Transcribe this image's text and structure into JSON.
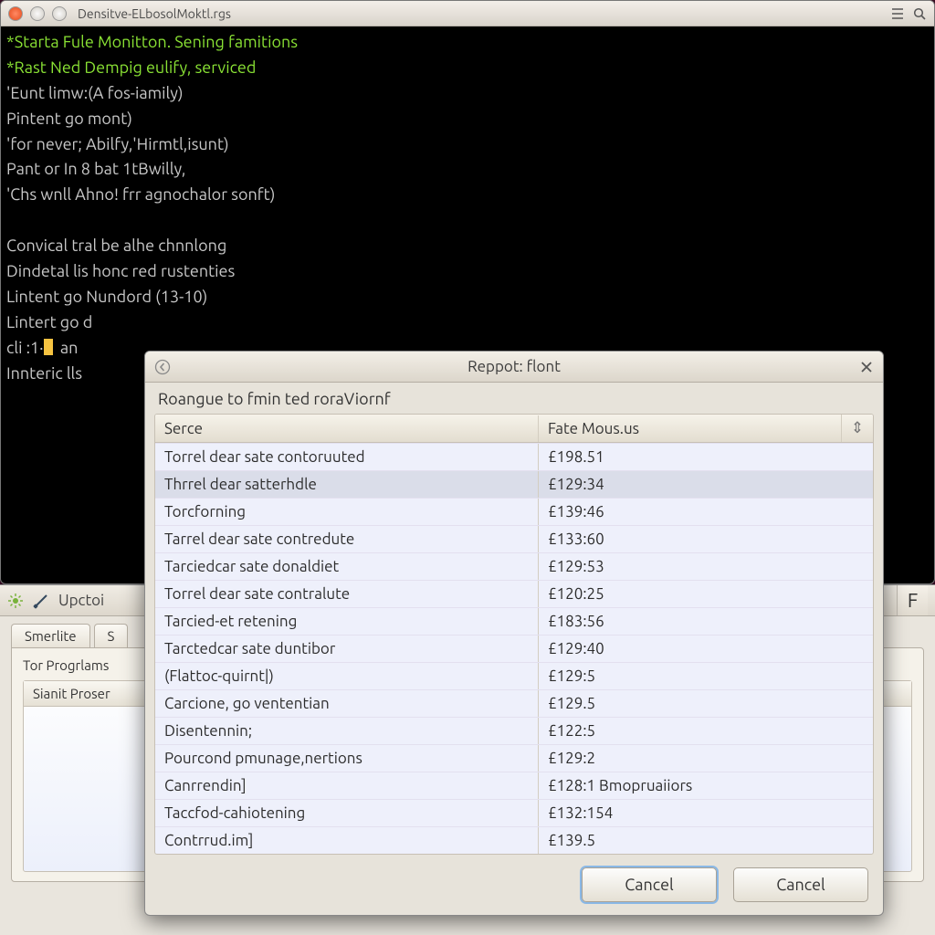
{
  "main_window": {
    "title": "Densitve-ELbosolMoktl.rgs",
    "terminal_lines": [
      {
        "cls": "term-highlight",
        "text": "*Starta Fule Monitton. Sening famitions"
      },
      {
        "cls": "term-highlight",
        "text": "*Rast Ned Dempig eulify, serviced"
      },
      {
        "cls": "term-gray",
        "text": "'Eunt limw:(A fos-iamily)"
      },
      {
        "cls": "term-gray",
        "text": "Pintent go mont)"
      },
      {
        "cls": "term-gray",
        "text": "'for never; Abilfy,'Hirmtl,isunt)"
      },
      {
        "cls": "term-gray",
        "text": "Pant or In 8 bat 1tBwilly,"
      },
      {
        "cls": "term-gray",
        "text": "'Chs wnll Ahno! frr agnochalor sonft)"
      },
      {
        "cls": "term-gray",
        "text": ""
      },
      {
        "cls": "term-gray",
        "text": "Convical tral be alhe chnnlong"
      },
      {
        "cls": "term-gray",
        "text": "Dindetal lis honc red rustenties"
      },
      {
        "cls": "term-gray",
        "text": "Lintent go Nundord (13-10)"
      },
      {
        "cls": "term-gray",
        "text": "Lintert go d"
      },
      {
        "cls": "term-gray",
        "text": "cli :1·  an"
      },
      {
        "cls": "term-gray",
        "text": "Innteric lls"
      }
    ]
  },
  "lower_window": {
    "title": "Upctoi",
    "right_glyph": "F",
    "tabs": [
      "Smerlite",
      "S"
    ],
    "section_label": "Tor Progrlams",
    "list_header": "Sianit Proser"
  },
  "dialog": {
    "title": "Reppot: flont",
    "subtitle": "Roangue to fmin ted roraViornf",
    "columns": {
      "serce": "Serce",
      "fate": "Fate Mous.us",
      "sort_glyph": "⇕"
    },
    "rows": [
      {
        "serce": "Torrel dear sate contoruuted",
        "fate": "£198.51"
      },
      {
        "serce": "Thrrel dear satterhdle",
        "fate": "£129:34"
      },
      {
        "serce": "Torcforning",
        "fate": "£139:46"
      },
      {
        "serce": "Tarrel dear sate contredute",
        "fate": "£133:60"
      },
      {
        "serce": "Tarciedcar sate donaldiet",
        "fate": "£129:53"
      },
      {
        "serce": "Torrel dear sate contralute",
        "fate": "£120:25"
      },
      {
        "serce": "Tarcied-et retening",
        "fate": "£183:56"
      },
      {
        "serce": "Tarctedcar sate duntibor",
        "fate": "£129:40"
      },
      {
        "serce": "(Flattoc-quirnt|)",
        "fate": "£129:5"
      },
      {
        "serce": "Carcione, go vententian",
        "fate": "£129.5"
      },
      {
        "serce": "Disentennin;",
        "fate": "£122:5"
      },
      {
        "serce": "Pourcond pmunage,nertions",
        "fate": "£129:2"
      },
      {
        "serce": "Canrrendin]",
        "fate": "£128:1 Bmopruaiiors"
      },
      {
        "serce": "Taccfod-cahiotening",
        "fate": "£132:154"
      },
      {
        "serce": "Contrrud.im]",
        "fate": "£139.5"
      }
    ],
    "buttons": {
      "primary": "Cancel",
      "secondary": "Cancel"
    }
  }
}
